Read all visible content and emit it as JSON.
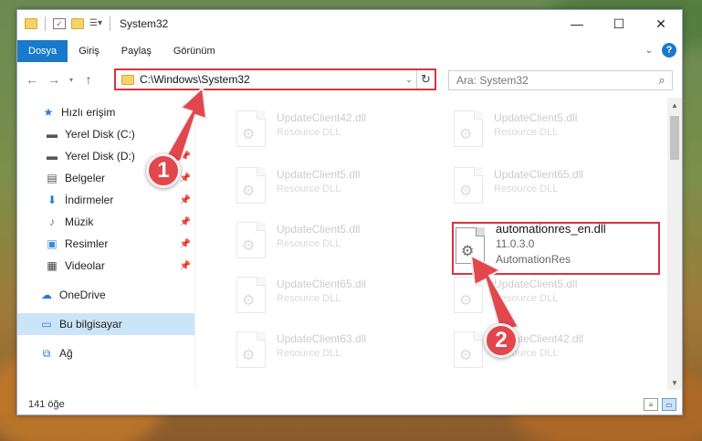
{
  "window": {
    "title": "System32",
    "controls": {
      "minimize": "—",
      "maximize": "☐",
      "close": "✕"
    }
  },
  "ribbon": {
    "tabs": [
      {
        "label": "Dosya",
        "active": true
      },
      {
        "label": "Giriş"
      },
      {
        "label": "Paylaş"
      },
      {
        "label": "Görünüm"
      }
    ],
    "help": "?"
  },
  "navigation": {
    "address": "C:\\Windows\\System32",
    "search_placeholder": "Ara: System32"
  },
  "sidebar": {
    "items": [
      {
        "label": "Hızlı erişim",
        "icon": "star-icon",
        "pinned": false
      },
      {
        "label": "Yerel Disk (C:)",
        "icon": "drive-icon",
        "pinned": true
      },
      {
        "label": "Yerel Disk (D:)",
        "icon": "drive-icon",
        "pinned": true
      },
      {
        "label": "Belgeler",
        "icon": "documents-icon",
        "pinned": true
      },
      {
        "label": "İndirmeler",
        "icon": "download-icon",
        "pinned": true
      },
      {
        "label": "Müzik",
        "icon": "music-icon",
        "pinned": true
      },
      {
        "label": "Resimler",
        "icon": "pictures-icon",
        "pinned": true
      },
      {
        "label": "Videolar",
        "icon": "video-icon",
        "pinned": true
      },
      {
        "label": "OneDrive",
        "icon": "cloud-icon",
        "pinned": false
      },
      {
        "label": "Bu bilgisayar",
        "icon": "computer-icon",
        "pinned": false,
        "selected": true
      },
      {
        "label": "Ağ",
        "icon": "network-icon",
        "pinned": false
      }
    ]
  },
  "files": [
    {
      "name": "UpdateClient42.dll",
      "type": "Resource DLL"
    },
    {
      "name": "UpdateClient5.dll",
      "type": "Resource DLL"
    },
    {
      "name": "UpdateClient5.dll",
      "type": "Resource DLL"
    },
    {
      "name": "UpdateClient65.dll",
      "type": "Resource DLL"
    },
    {
      "name": "UpdateClient5.dll",
      "type": "Resource DLL"
    },
    {
      "name": "automationres_en.dll",
      "version": "11.0.3.0",
      "type": "AutomationRes",
      "highlighted": true
    },
    {
      "name": "UpdateClient65.dll",
      "type": "Resource DLL"
    },
    {
      "name": "UpdateClient5.dll",
      "type": "Resource DLL"
    },
    {
      "name": "UpdateClient63.dll",
      "type": "Resource DLL"
    },
    {
      "name": "UpdateClient42.dll",
      "type": "Resource DLL"
    }
  ],
  "status": {
    "item_count": "141 öğe"
  },
  "annotations": [
    {
      "number": "1"
    },
    {
      "number": "2"
    }
  ],
  "colors": {
    "accent": "#1979ca",
    "highlight": "#d9333f",
    "badge": "#e2474e"
  }
}
